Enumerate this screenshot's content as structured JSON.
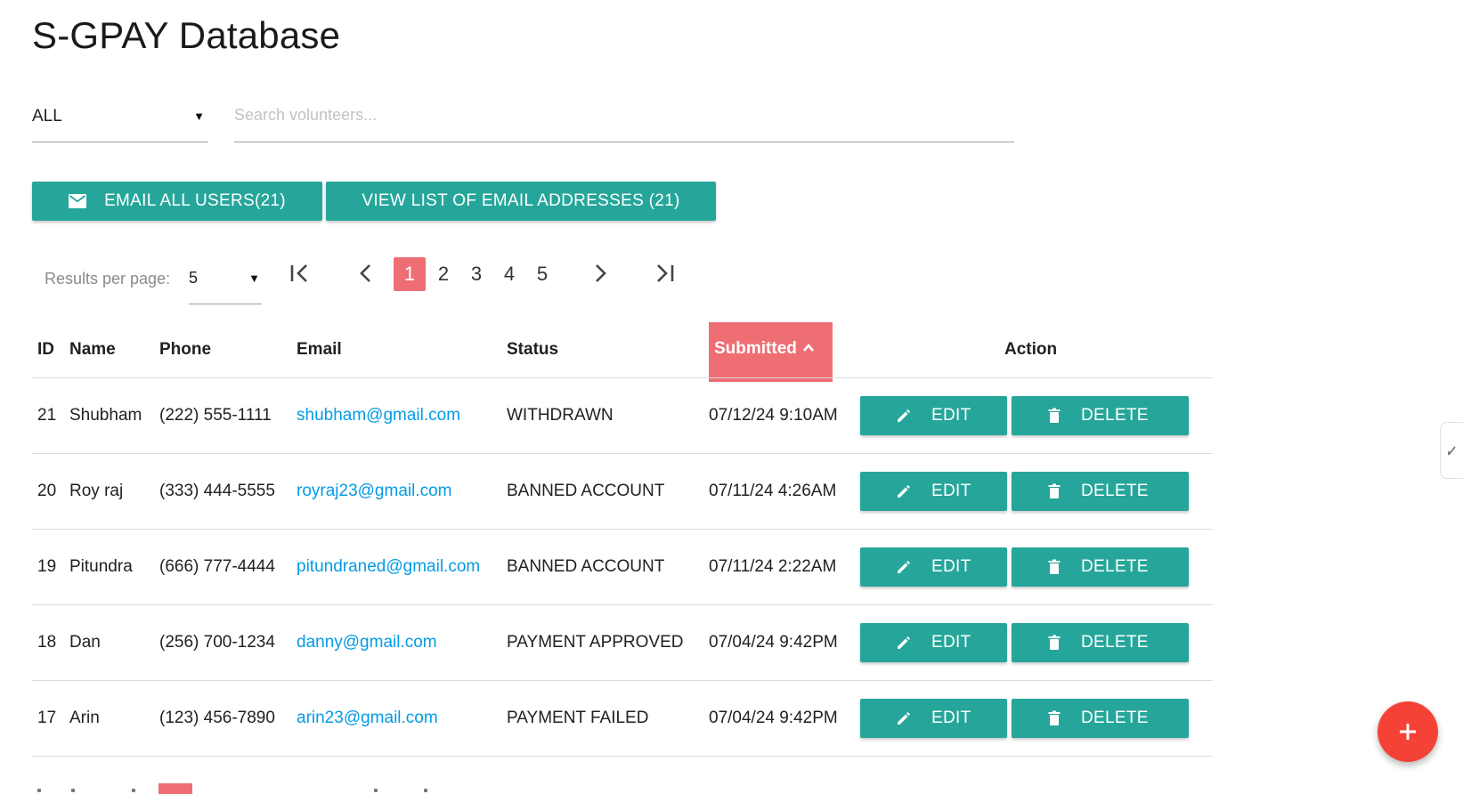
{
  "page": {
    "title": "S-GPAY Database"
  },
  "filter": {
    "selected": "ALL",
    "search_placeholder": "Search volunteers...",
    "search_value": ""
  },
  "toolbar": {
    "email_all_label": "EMAIL ALL USERS(21)",
    "view_list_label": "VIEW LIST OF EMAIL ADDRESSES (21)"
  },
  "pagination": {
    "results_label": "Results per page:",
    "per_page": "5",
    "pages": [
      "1",
      "2",
      "3",
      "4",
      "5"
    ],
    "current_page": "1"
  },
  "table": {
    "headers": {
      "id": "ID",
      "name": "Name",
      "phone": "Phone",
      "email": "Email",
      "status": "Status",
      "submitted": "Submitted",
      "action": "Action"
    },
    "sort": {
      "column": "Submitted",
      "direction": "ascending"
    },
    "edit_label": "EDIT",
    "delete_label": "DELETE",
    "rows": [
      {
        "id": "21",
        "name": "Shubham",
        "phone": "(222) 555-1111",
        "email": "shubham@gmail.com",
        "status": "WITHDRAWN",
        "submitted": "07/12/24 9:10AM"
      },
      {
        "id": "20",
        "name": "Roy raj",
        "phone": "(333) 444-5555",
        "email": "royraj23@gmail.com",
        "status": "BANNED ACCOUNT",
        "submitted": "07/11/24 4:26AM"
      },
      {
        "id": "19",
        "name": "Pitundra",
        "phone": "(666) 777-4444",
        "email": "pitundraned@gmail.com",
        "status": "BANNED ACCOUNT",
        "submitted": "07/11/24 2:22AM"
      },
      {
        "id": "18",
        "name": "Dan",
        "phone": "(256) 700-1234",
        "email": "danny@gmail.com",
        "status": "PAYMENT APPROVED",
        "submitted": "07/04/24 9:42PM"
      },
      {
        "id": "17",
        "name": "Arin",
        "phone": "(123) 456-7890",
        "email": "arin23@gmail.com",
        "status": "PAYMENT FAILED",
        "submitted": "07/04/24 9:42PM"
      }
    ]
  },
  "icons": {
    "email": "mail-icon",
    "first": "first-page-icon",
    "prev": "chevron-left-icon",
    "next": "chevron-right-icon",
    "last": "last-page-icon",
    "sort": "chevron-up-icon",
    "edit": "pencil-icon",
    "delete": "trash-icon",
    "fab": "plus-icon"
  },
  "colors": {
    "primary": "#26a69a",
    "accent": "#ee6e73",
    "link": "#039be5",
    "fab": "#f44336"
  }
}
